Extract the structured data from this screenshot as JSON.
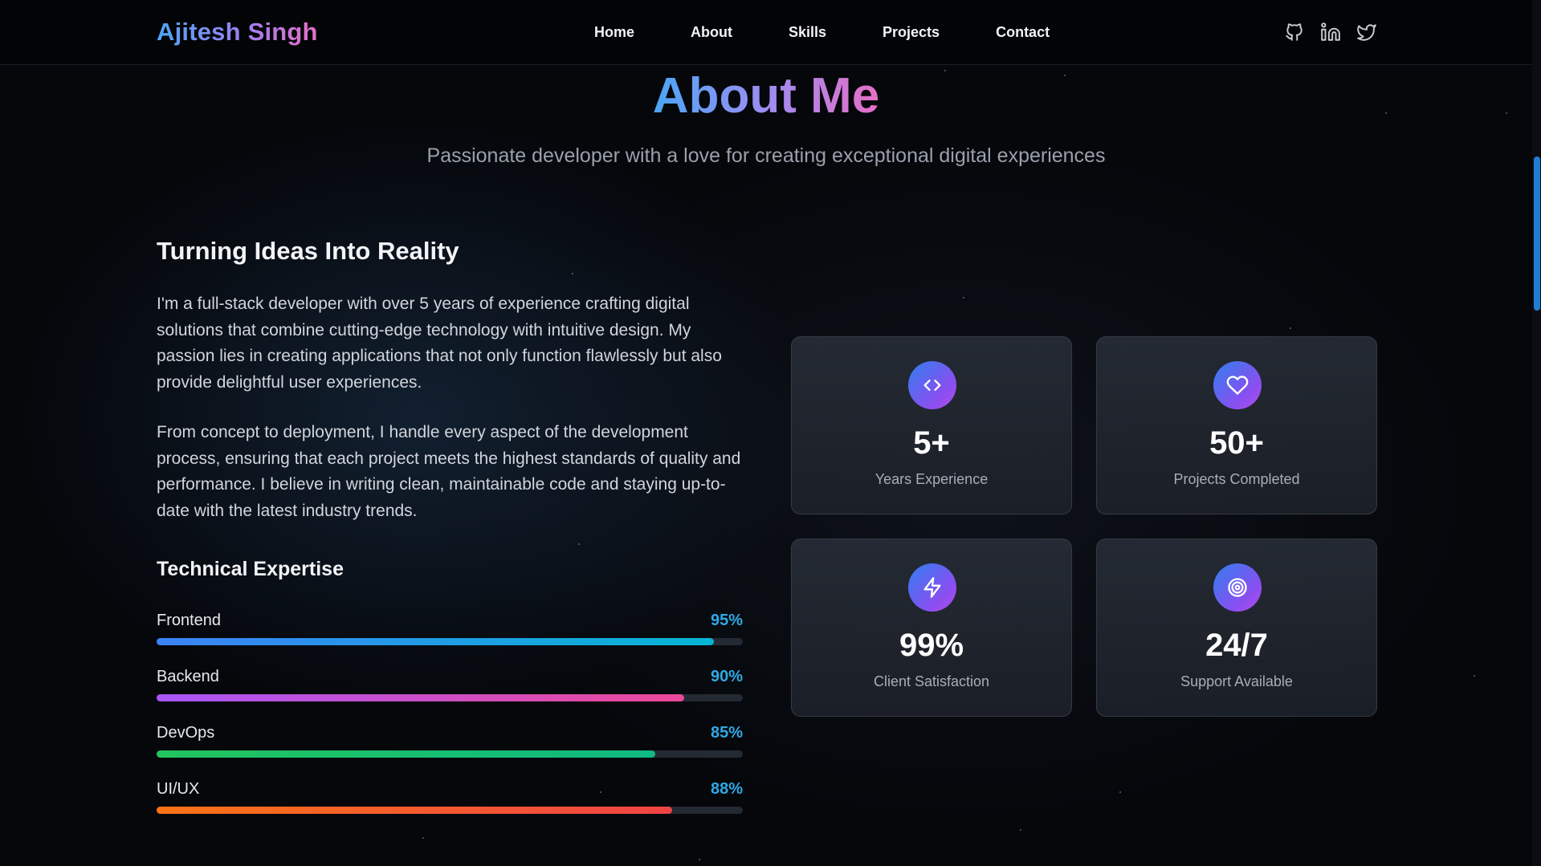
{
  "header": {
    "brand": "Ajitesh Singh",
    "nav": [
      "Home",
      "About",
      "Skills",
      "Projects",
      "Contact"
    ],
    "socials": [
      "github-icon",
      "linkedin-icon",
      "twitter-icon"
    ]
  },
  "about": {
    "title": "About Me",
    "subtitle": "Passionate developer with a love for creating exceptional digital experiences",
    "heading": "Turning Ideas Into Reality",
    "paragraphs": [
      "I'm a full-stack developer with over 5 years of experience crafting digital solutions that combine cutting-edge technology with intuitive design. My passion lies in creating applications that not only function flawlessly but also provide delightful user experiences.",
      "From concept to deployment, I handle every aspect of the development process, ensuring that each project meets the highest standards of quality and performance. I believe in writing clean, maintainable code and staying up-to-date with the latest industry trends."
    ],
    "expertise_heading": "Technical Expertise",
    "skills": [
      {
        "name": "Frontend",
        "percent_label": "95%",
        "level": 95,
        "colors": [
          "#3b82f6",
          "#06b6d4"
        ]
      },
      {
        "name": "Backend",
        "percent_label": "90%",
        "level": 90,
        "colors": [
          "#a855f7",
          "#ec4899"
        ]
      },
      {
        "name": "DevOps",
        "percent_label": "85%",
        "level": 85,
        "colors": [
          "#22c55e",
          "#10b981"
        ]
      },
      {
        "name": "UI/UX",
        "percent_label": "88%",
        "level": 88,
        "colors": [
          "#f97316",
          "#ef4444"
        ]
      }
    ],
    "stats": [
      {
        "icon": "code-icon",
        "value": "5+",
        "label": "Years Experience"
      },
      {
        "icon": "heart-icon",
        "value": "50+",
        "label": "Projects Completed"
      },
      {
        "icon": "lightning-icon",
        "value": "99%",
        "label": "Client Satisfaction"
      },
      {
        "icon": "target-icon",
        "value": "24/7",
        "label": "Support Available"
      }
    ]
  }
}
